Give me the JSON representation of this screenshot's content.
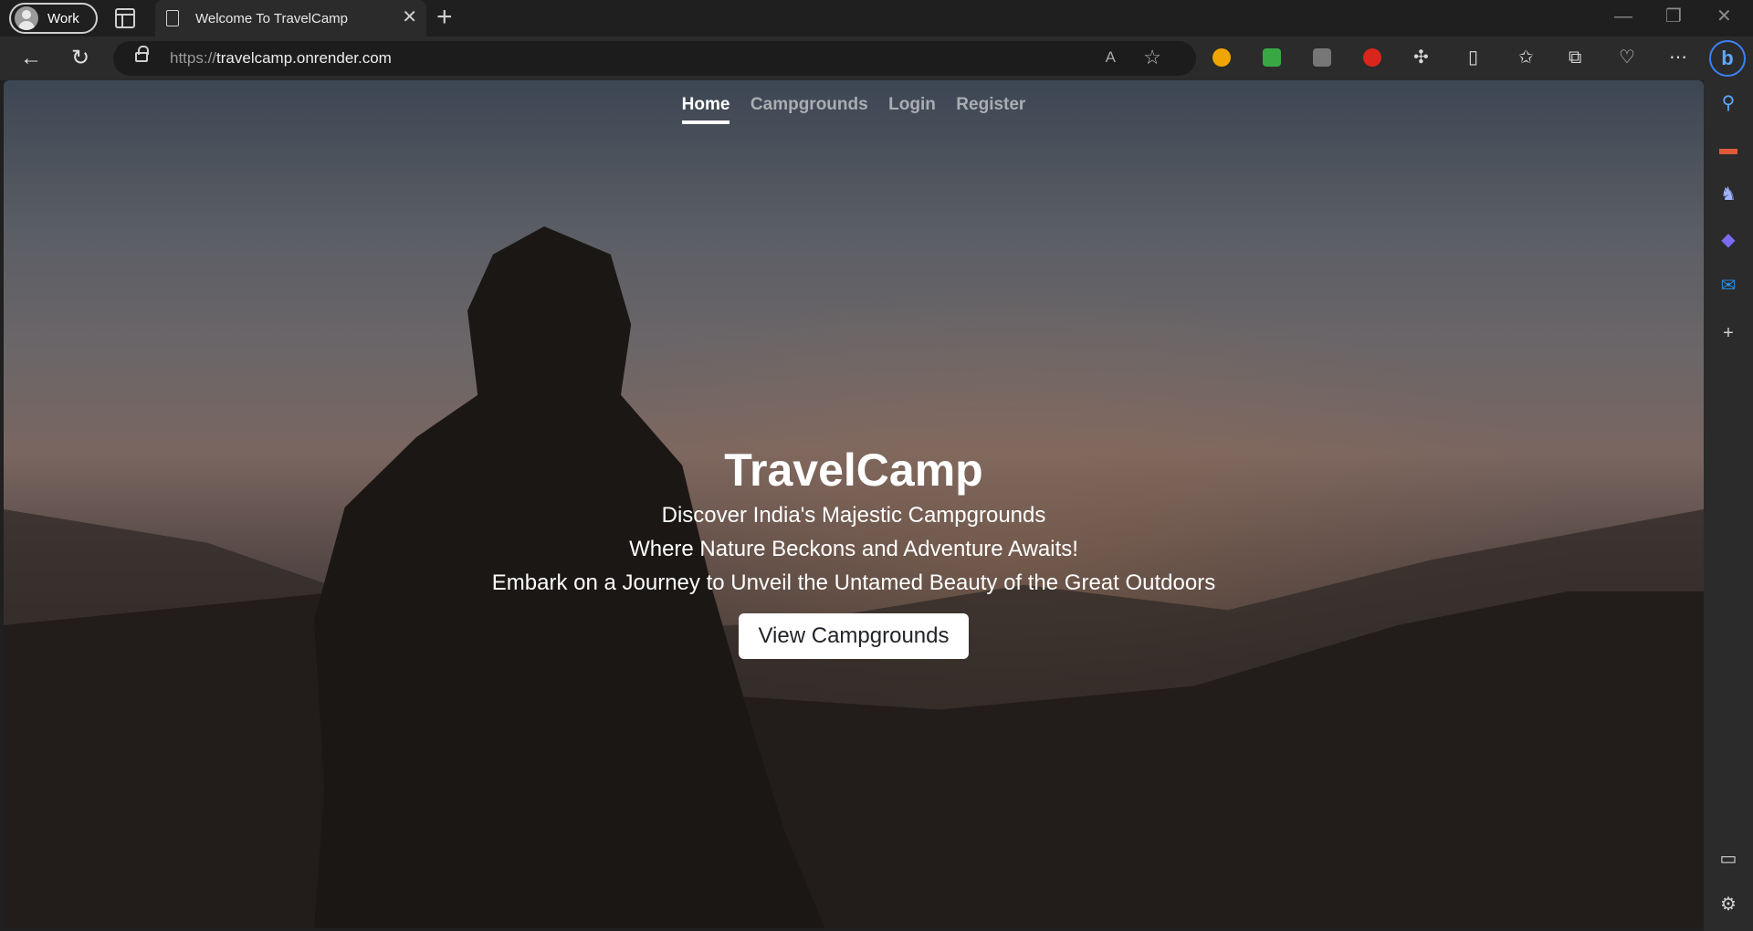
{
  "browser": {
    "profile_label": "Work",
    "tab_title": "Welcome To TravelCamp",
    "url_scheme": "https://",
    "url_host": "travelcamp.onrender.com"
  },
  "site": {
    "nav": {
      "home": "Home",
      "campgrounds": "Campgrounds",
      "login": "Login",
      "register": "Register"
    },
    "hero": {
      "title": "TravelCamp",
      "line1": "Discover India's Majestic Campgrounds",
      "line2": "Where Nature Beckons and Adventure Awaits!",
      "line3": "Embark on a Journey to Unveil the Untamed Beauty of the Great Outdoors",
      "button": "View Campgrounds"
    }
  }
}
